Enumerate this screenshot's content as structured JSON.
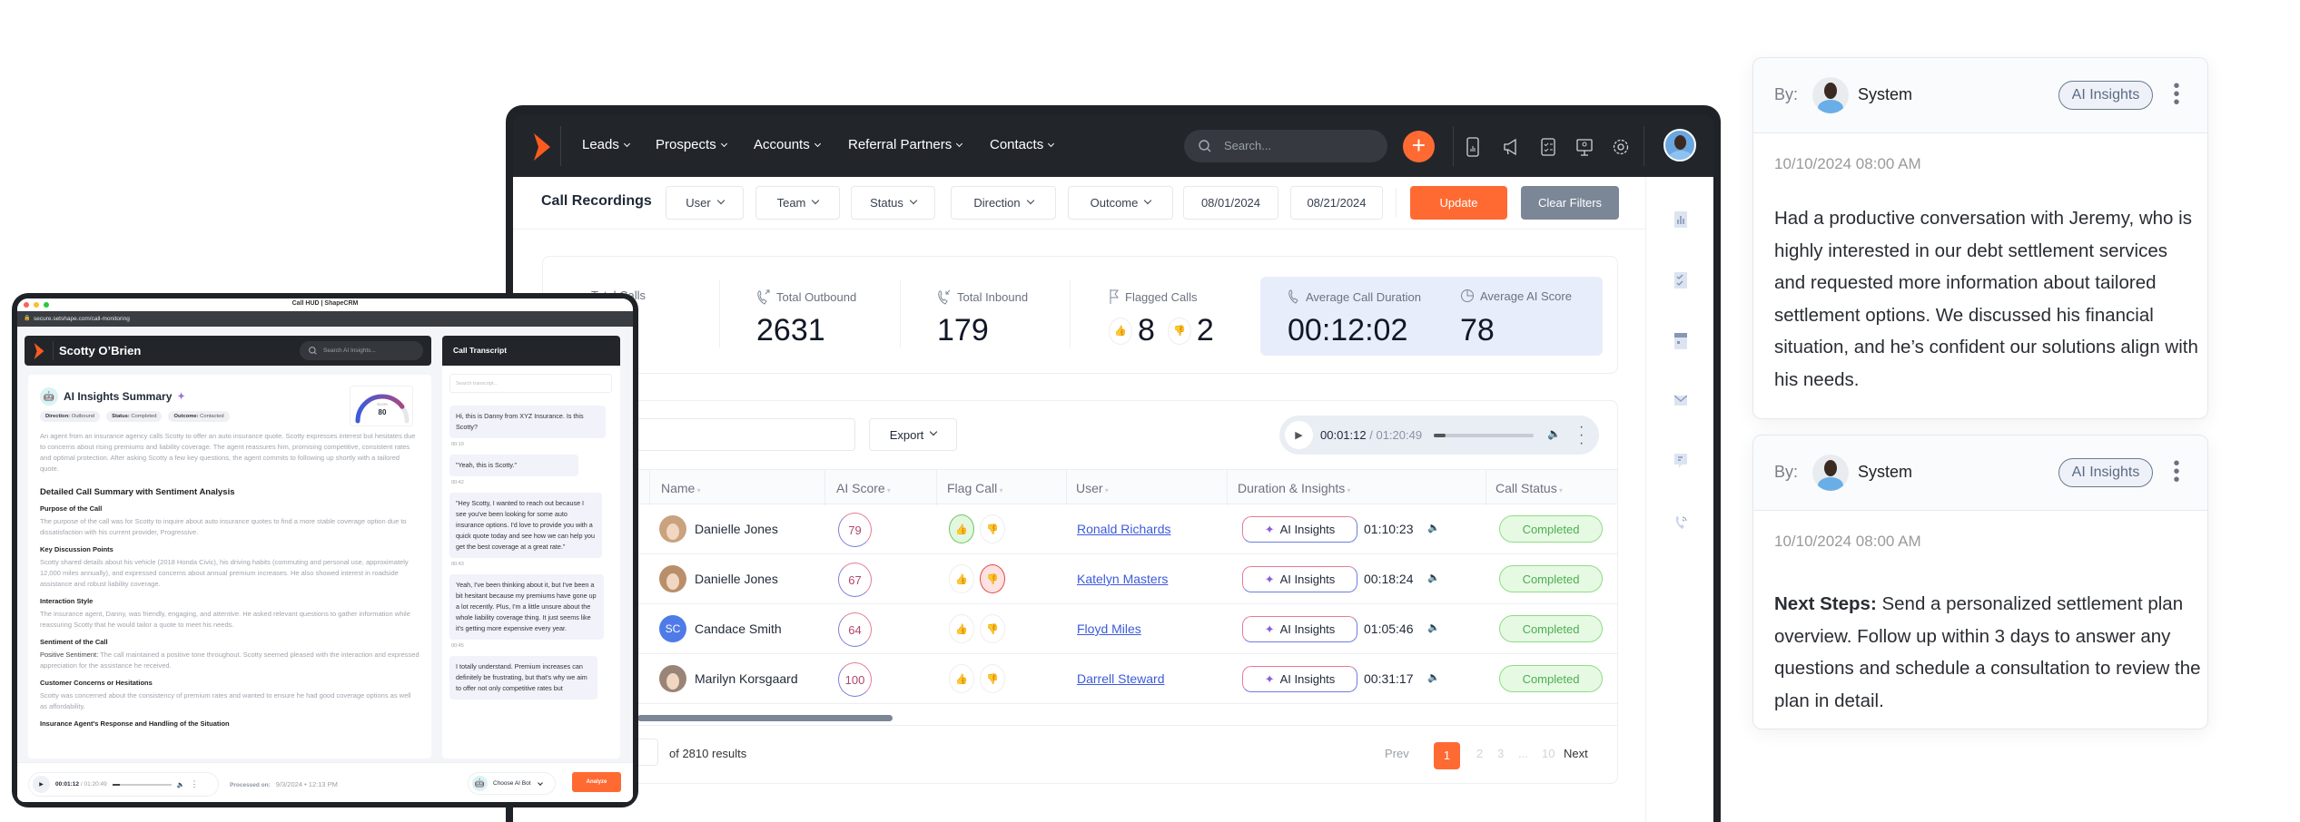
{
  "crm": {
    "nav": [
      "Leads",
      "Prospects",
      "Accounts",
      "Referral Partners",
      "Contacts"
    ],
    "search_placeholder": "Search...",
    "page_title": "Call Recordings",
    "filters": [
      "User",
      "Team",
      "Status",
      "Direction",
      "Outcome"
    ],
    "date_from": "08/01/2024",
    "date_to": "08/21/2024",
    "update_label": "Update",
    "clear_label": "Clear Filters",
    "accent": "#ff6a33",
    "stats": {
      "total_calls_label": "Total Calls",
      "outbound_label": "Total Outbound",
      "outbound_value": "2631",
      "inbound_label": "Total Inbound",
      "inbound_value": "179",
      "flagged_label": "Flagged Calls",
      "flagged_up": "8",
      "flagged_down": "2",
      "avg_duration_label": "Average Call Duration",
      "avg_duration_value": "00:12:02",
      "avg_score_label": "Average AI Score",
      "avg_score_value": "78"
    },
    "table": {
      "export_label": "Export",
      "player_time": "00:01:12",
      "player_total": "/ 01:20:49",
      "columns": [
        "Name",
        "AI Score",
        "Flag Call",
        "User",
        "Duration & Insights",
        "Call Status"
      ],
      "insights_label": "AI Insights",
      "rows": [
        {
          "name": "Danielle Jones",
          "avatar": "photo",
          "score": "79",
          "flag": "up",
          "user": "Ronald Richards",
          "duration": "01:10:23",
          "status": "Completed"
        },
        {
          "name": "Danielle Jones",
          "avatar": "photo",
          "score": "67",
          "flag": "down",
          "user": "Katelyn Masters",
          "duration": "00:18:24",
          "status": "Completed"
        },
        {
          "name": "Candace Smith",
          "avatar": "SC",
          "score": "64",
          "flag": "none",
          "user": "Floyd Miles",
          "duration": "01:05:46",
          "status": "Completed"
        },
        {
          "name": "Marilyn Korsgaard",
          "avatar": "photo",
          "score": "100",
          "flag": "none",
          "user": "Darrell Steward",
          "duration": "00:31:17",
          "status": "Completed"
        }
      ],
      "results_text": "of 2810 results",
      "pagination": {
        "prev": "Prev",
        "pages": [
          "1",
          "2",
          "3",
          "...",
          "10"
        ],
        "current": "1",
        "next": "Next"
      }
    }
  },
  "hud": {
    "window_title": "Call HUD | ShapeCRM",
    "url": "secure.setshape.com/call-monitoring",
    "contact_name": "Scotty O’Brien",
    "search_placeholder": "Search AI Insights...",
    "summary_title": "AI Insights Summary",
    "chips": [
      {
        "label": "Direction:",
        "value": "Outbound"
      },
      {
        "label": "Status:",
        "value": "Completed"
      },
      {
        "label": "Outcome:",
        "value": "Contacted"
      }
    ],
    "gauge": {
      "label": "Score",
      "value": 80
    },
    "summary": "An agent from an insurance agency calls Scotty to offer an auto insurance quote. Scotty expresses interest but hesitates due to concerns about rising premiums and liability coverage. The agent reassures him, promising competitive, consistent rates and optimal protection. After asking Scotty a few key questions, the agent commits to following up shortly with a tailored quote.",
    "detail_title": "Detailed Call Summary with Sentiment Analysis",
    "sections": [
      {
        "title": "Purpose of the Call",
        "text": "The purpose of the call was for Scotty to inquire about auto insurance quotes to find a more stable coverage option due to dissatisfaction with his current provider, Progressive."
      },
      {
        "title": "Key Discussion Points",
        "text": "Scotty shared details about his vehicle (2018 Honda Civic), his driving habits (commuting and personal use, approximately 12,000 miles annually), and expressed concerns about annual premium increases. He also showed interest in roadside assistance and robust liability coverage."
      },
      {
        "title": "Interaction Style",
        "text": "The insurance agent, Danny, was friendly, engaging, and attentive. He asked relevant questions to gather information while reassuring Scotty that he would tailor a quote to meet his needs."
      },
      {
        "title": "Sentiment of the Call",
        "lead": "Positive Sentiment:",
        "text": " The call maintained a positive tone throughout. Scotty seemed pleased with the interaction and expressed appreciation for the assistance he received."
      },
      {
        "title": "Customer Concerns or Hesitations",
        "text": "Scotty was concerned about the consistency of premium rates and wanted to ensure he had good coverage options as well as affordability."
      },
      {
        "title": "Insurance Agent's Response and Handling of the Situation",
        "text": ""
      }
    ],
    "transcript_title": "Call Transcript",
    "transcript_search_placeholder": "Search transcript...",
    "messages": [
      {
        "text": "Hi, this is Danny from XYZ Insurance. Is this Scotty?",
        "time": "00:10"
      },
      {
        "text": "\"Yeah, this is Scotty.\"",
        "time": "00:42"
      },
      {
        "text": "\"Hey Scotty, I wanted to reach out because I see you've been looking for some auto insurance options. I'd love to provide you with a quick quote today and see how we can help you get the best coverage at a great rate.\"",
        "time": "00:43"
      },
      {
        "text": "Yeah, I've been thinking about it, but I've been a bit hesitant because my premiums have gone up a lot recently. Plus, I'm a little unsure about the whole liability coverage thing. It just seems like it's getting more expensive every year.",
        "time": "00:45"
      },
      {
        "text": "I totally understand. Premium increases can definitely be frustrating, but that's why we aim to offer not only competitive rates but",
        "time": ""
      }
    ],
    "player_time": "00:01:12",
    "player_total": "/ 01:20:49",
    "processed_label": "Processed on:",
    "processed_value": "9/3/2024 • 12:13 PM",
    "ai_bot_label": "Choose AI Bot",
    "analyze_label": "Analyze"
  },
  "notes": [
    {
      "by": "By:",
      "author": "System",
      "badge": "AI Insights",
      "date": "10/10/2024 08:00 AM",
      "lead": "",
      "body": "Had a productive conversation with Jeremy, who is highly interested in our debt settlement services and requested more information about tailored settlement options. We discussed his financial situation, and he’s confident our solutions align with his needs."
    },
    {
      "by": "By:",
      "author": "System",
      "badge": "AI Insights",
      "date": "10/10/2024 08:00 AM",
      "lead": "Next Steps:",
      "body": " Send a personalized settlement plan overview. Follow up within 3 days to answer any questions and schedule a consultation to review the plan in detail."
    }
  ]
}
